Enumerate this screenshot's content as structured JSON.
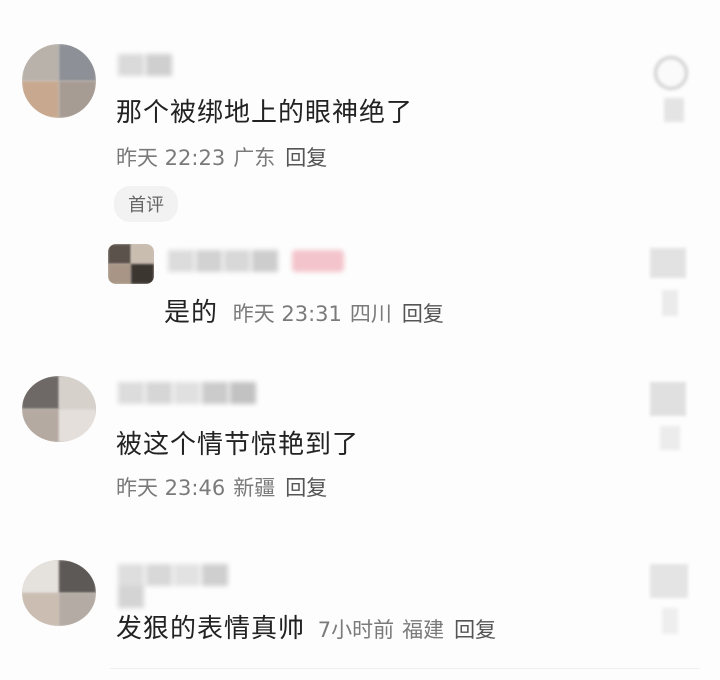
{
  "comments": [
    {
      "text": "那个被绑地上的眼神绝了",
      "time": "昨天 22:23",
      "location": "广东",
      "reply_label": "回复",
      "badge": "首评",
      "replies": [
        {
          "text": "是的",
          "time": "昨天 23:31",
          "location": "四川",
          "reply_label": "回复"
        }
      ]
    },
    {
      "text": "被这个情节惊艳到了",
      "time": "昨天 23:46",
      "location": "新疆",
      "reply_label": "回复"
    },
    {
      "text": "发狠的表情真帅",
      "time": "7小时前",
      "location": "福建",
      "reply_label": "回复"
    }
  ],
  "icons": {
    "like": "heart-icon",
    "avatar": "user-avatar"
  }
}
